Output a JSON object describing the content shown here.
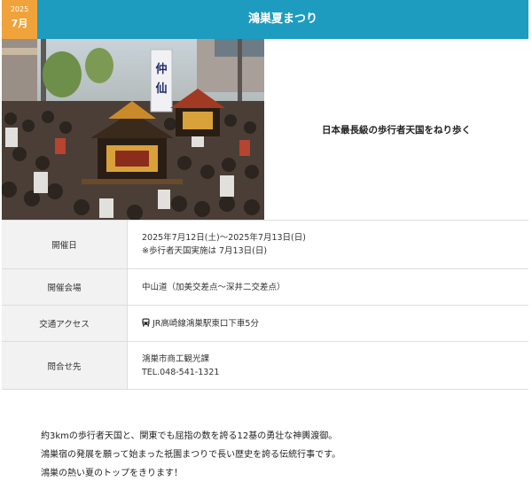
{
  "header": {
    "year": "2025",
    "month": "7月",
    "title": "鴻巣夏まつり"
  },
  "hero": {
    "photo_sign": "仲仙",
    "tagline": "日本最長級の歩行者天国をねり歩く"
  },
  "info": [
    {
      "label": "開催日",
      "lines": [
        "2025年7月12日(土)～2025年7月13日(日)",
        "※歩行者天国実施は 7月13日(日)"
      ]
    },
    {
      "label": "開催会場",
      "lines": [
        "中山道（加美交差点～深井二交差点）"
      ]
    },
    {
      "label": "交通アクセス",
      "icon": "bus-icon",
      "lines": [
        "JR高崎線鴻巣駅東口下車5分"
      ]
    },
    {
      "label": "問合せ先",
      "lines": [
        "鴻巣市商工観光課",
        "TEL.048-541-1321"
      ]
    }
  ],
  "description": [
    "約3kmの歩行者天国と、関東でも屈指の数を誇る12基の勇壮な神輿渡御。",
    "鴻巣宿の発展を願って始まった祇園まつりで長い歴史を誇る伝統行事です。",
    "鴻巣の熱い夏のトップをきります！"
  ],
  "colors": {
    "header_bg": "#1d9cc0",
    "badge_bg": "#f0a33a",
    "label_bg": "#f2f2f2"
  }
}
